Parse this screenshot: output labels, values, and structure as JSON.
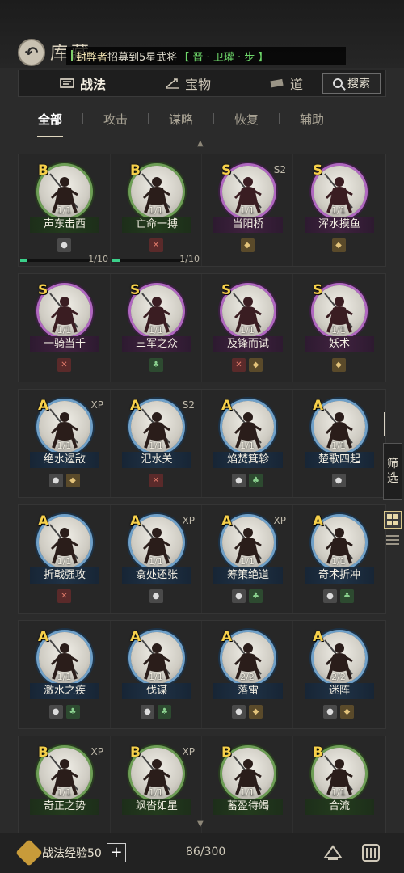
{
  "header": {
    "title": "库藏",
    "ticker": {
      "name": "封弊者",
      "message": "招募到5星武将",
      "highlight": "【 晋 · 卫瓘 · 步 】"
    }
  },
  "nav": {
    "tabs": [
      {
        "label": "战法",
        "icon": "scroll-icon",
        "active": true
      },
      {
        "label": "宝物",
        "icon": "weapon-icon",
        "active": false
      },
      {
        "label": "道",
        "icon": "prop-icon",
        "active": false
      }
    ],
    "search_label": "搜索"
  },
  "subtabs": [
    "全部",
    "攻击",
    "谋略",
    "恢复",
    "辅助"
  ],
  "rows": [
    [
      {
        "grade": "B",
        "name": "声东击西",
        "count": "1/1",
        "tag": "",
        "icons": [
          "gray"
        ],
        "progress": {
          "value": 0.1,
          "text": "1/10"
        }
      },
      {
        "grade": "B",
        "name": "亡命一搏",
        "count": "1/1",
        "tag": "",
        "icons": [
          "red"
        ],
        "progress": {
          "value": 0.1,
          "text": "1/10"
        }
      },
      {
        "grade": "S",
        "name": "当阳桥",
        "count": "1/1",
        "tag": "S2",
        "icons": [
          "gold"
        ],
        "progress": null
      },
      {
        "grade": "S",
        "name": "浑水摸鱼",
        "count": "1/1",
        "tag": "",
        "icons": [
          "gold"
        ],
        "progress": null
      }
    ],
    [
      {
        "grade": "S",
        "name": "一骑当千",
        "count": "1/1",
        "tag": "",
        "icons": [
          "red"
        ]
      },
      {
        "grade": "S",
        "name": "三军之众",
        "count": "1/1",
        "tag": "",
        "icons": [
          "green"
        ]
      },
      {
        "grade": "S",
        "name": "及锋而试",
        "count": "1/1",
        "tag": "",
        "icons": [
          "red",
          "gold"
        ]
      },
      {
        "grade": "S",
        "name": "妖术",
        "count": "1/1",
        "tag": "",
        "icons": [
          "gold"
        ]
      }
    ],
    [
      {
        "grade": "A",
        "name": "绝水遏敌",
        "count": "1/1",
        "tag": "XP",
        "icons": [
          "gray",
          "gold"
        ]
      },
      {
        "grade": "A",
        "name": "汜水关",
        "count": "1/1",
        "tag": "S2",
        "icons": [
          "red"
        ]
      },
      {
        "grade": "A",
        "name": "焰焚箕轸",
        "count": "1/1",
        "tag": "",
        "icons": [
          "gray",
          "green"
        ]
      },
      {
        "grade": "A",
        "name": "楚歌四起",
        "count": "1/1",
        "tag": "",
        "icons": [
          "gray"
        ]
      }
    ],
    [
      {
        "grade": "A",
        "name": "折戟强攻",
        "count": "1/1",
        "tag": "",
        "icons": [
          "red"
        ]
      },
      {
        "grade": "A",
        "name": "翕处还张",
        "count": "1/1",
        "tag": "XP",
        "icons": [
          "gray"
        ]
      },
      {
        "grade": "A",
        "name": "筹策绝道",
        "count": "1/1",
        "tag": "XP",
        "icons": [
          "gray",
          "green"
        ]
      },
      {
        "grade": "A",
        "name": "奇术折冲",
        "count": "1/1",
        "tag": "",
        "icons": [
          "gray",
          "green"
        ]
      }
    ],
    [
      {
        "grade": "A",
        "name": "激水之疾",
        "count": "1/1",
        "tag": "",
        "icons": [
          "gray",
          "green"
        ]
      },
      {
        "grade": "A",
        "name": "伐谋",
        "count": "1/1",
        "tag": "",
        "icons": [
          "gray",
          "green"
        ]
      },
      {
        "grade": "A",
        "name": "落雷",
        "count": "2/2",
        "tag": "",
        "icons": [
          "gray",
          "gold"
        ]
      },
      {
        "grade": "A",
        "name": "迷阵",
        "count": "2/2",
        "tag": "",
        "icons": [
          "gray",
          "gold"
        ]
      }
    ],
    [
      {
        "grade": "B",
        "name": "奇正之势",
        "count": "1/1",
        "tag": "XP",
        "icons": []
      },
      {
        "grade": "B",
        "name": "飒沓如星",
        "count": "1/1",
        "tag": "XP",
        "icons": []
      },
      {
        "grade": "B",
        "name": "蓄盈待竭",
        "count": "1/1",
        "tag": "",
        "icons": []
      },
      {
        "grade": "B",
        "name": "合流",
        "count": "1/1",
        "tag": "",
        "icons": []
      }
    ]
  ],
  "side": {
    "filter_label": "筛选"
  },
  "footer": {
    "exp_label": "战法经验50",
    "plus": "+",
    "capacity": "86/300"
  },
  "colors": {
    "grade_B": "#6d9e55",
    "grade_S": "#b067c0",
    "grade_A": "#6fa0c8",
    "grade_text": "#f6d04a",
    "ticker_highlight": "#6ed86a"
  }
}
